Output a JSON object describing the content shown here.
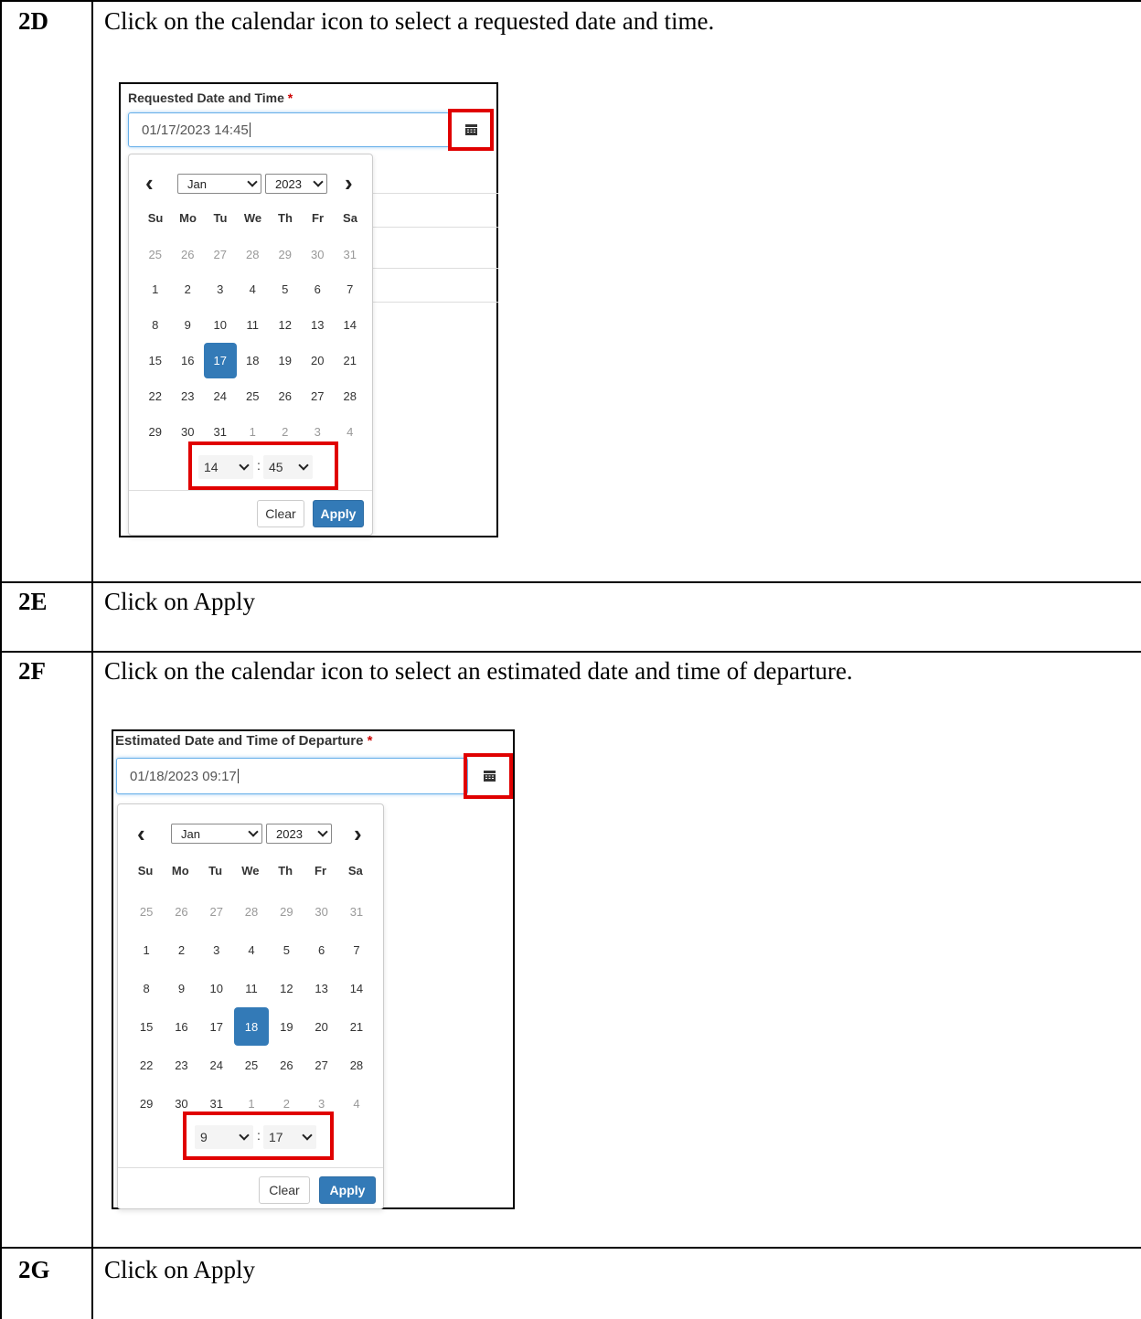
{
  "steps": [
    {
      "id": "2D",
      "text": "Click on the calendar icon to select a requested date and time."
    },
    {
      "id": "2E",
      "text": "Click on Apply"
    },
    {
      "id": "2F",
      "text": "Click on the calendar icon to select an estimated date and time of departure."
    },
    {
      "id": "2G",
      "text": "Click on Apply"
    }
  ],
  "picker1": {
    "label": "Requested Date and Time",
    "required_mark": "*",
    "value": "01/17/2023 14:45",
    "month": "Jan",
    "year": "2023",
    "prev": "‹",
    "next": "›",
    "weekdays": [
      "Su",
      "Mo",
      "Tu",
      "We",
      "Th",
      "Fr",
      "Sa"
    ],
    "days": [
      [
        "25",
        "26",
        "27",
        "28",
        "29",
        "30",
        "31"
      ],
      [
        "1",
        "2",
        "3",
        "4",
        "5",
        "6",
        "7"
      ],
      [
        "8",
        "9",
        "10",
        "11",
        "12",
        "13",
        "14"
      ],
      [
        "15",
        "16",
        "17",
        "18",
        "19",
        "20",
        "21"
      ],
      [
        "22",
        "23",
        "24",
        "25",
        "26",
        "27",
        "28"
      ],
      [
        "29",
        "30",
        "31",
        "1",
        "2",
        "3",
        "4"
      ]
    ],
    "selected_day": "17",
    "hour": "14",
    "minute": "45",
    "time_sep": ":",
    "clear_label": "Clear",
    "apply_label": "Apply"
  },
  "picker2": {
    "label": "Estimated Date and Time of Departure",
    "required_mark": "*",
    "value": "01/18/2023 09:17",
    "month": "Jan",
    "year": "2023",
    "prev": "‹",
    "next": "›",
    "weekdays": [
      "Su",
      "Mo",
      "Tu",
      "We",
      "Th",
      "Fr",
      "Sa"
    ],
    "days": [
      [
        "25",
        "26",
        "27",
        "28",
        "29",
        "30",
        "31"
      ],
      [
        "1",
        "2",
        "3",
        "4",
        "5",
        "6",
        "7"
      ],
      [
        "8",
        "9",
        "10",
        "11",
        "12",
        "13",
        "14"
      ],
      [
        "15",
        "16",
        "17",
        "18",
        "19",
        "20",
        "21"
      ],
      [
        "22",
        "23",
        "24",
        "25",
        "26",
        "27",
        "28"
      ],
      [
        "29",
        "30",
        "31",
        "1",
        "2",
        "3",
        "4"
      ]
    ],
    "selected_day": "18",
    "hour": "9",
    "minute": "17",
    "time_sep": ":",
    "clear_label": "Clear",
    "apply_label": "Apply"
  },
  "colors": {
    "highlight": "#e00000",
    "accent": "#337ab7"
  },
  "icons": {
    "calendar": "calendar-icon"
  }
}
